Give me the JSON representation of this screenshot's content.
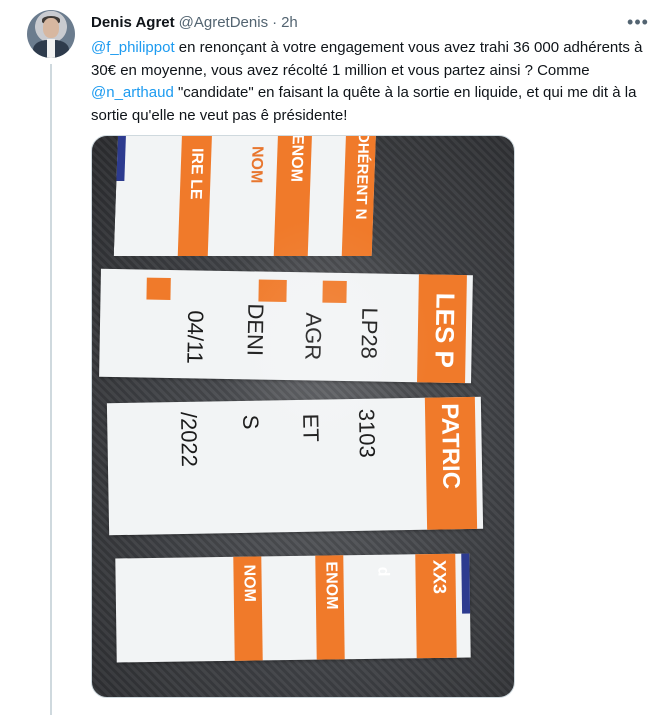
{
  "tweet": {
    "author_name": "Denis Agret",
    "author_handle": "@AgretDenis",
    "separator": "·",
    "time": "2h",
    "more_label": "•••",
    "text_parts": {
      "mention1": "@f_philippot",
      "part1": " en renonçant à votre engagement vous avez trahi 36 000 adhérents à 30€ en moyenne, vous avez récolté 1 million et vous partez ainsi ? Comme ",
      "mention2": "@n_arthaud",
      "part2": " \"candidate\" en faisant la quête à la sortie en liquide, et qui me dit à la sortie qu'elle ne veut pas ê présidente!"
    }
  },
  "photo": {
    "alt": "Torn membership card pieces on a grey carpet",
    "card_text": {
      "top_fragments": [
        "IRE LE",
        "ENOM",
        "NOM",
        "DHÉRENT N"
      ],
      "header": "LES P",
      "patric": "PATRIC",
      "date_a": "04/11",
      "date_b": "/2022",
      "name_a": "DENI",
      "name_b": "S",
      "surname_a": "AGR",
      "surname_b": "ET",
      "number_a": "LP28",
      "number_b": "3103",
      "code": "XX3",
      "bottom_fragments": [
        "NOM",
        "ENOM",
        "d"
      ]
    }
  }
}
